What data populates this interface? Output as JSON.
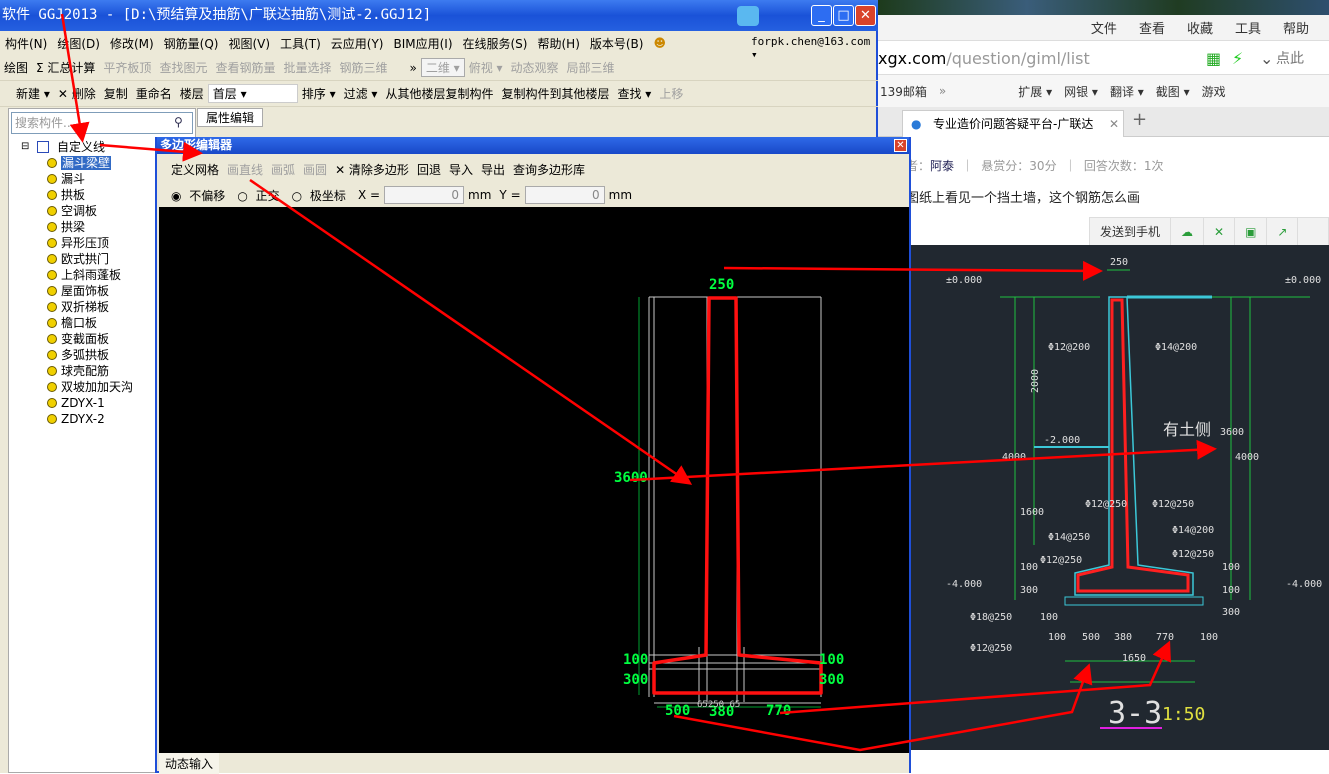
{
  "app": {
    "title": "软件 GGJ2013 - [D:\\预结算及抽筋\\广联达抽筋\\测试-2.GGJ12]",
    "menu": [
      "构件(N)",
      "绘图(D)",
      "修改(M)",
      "钢筋量(Q)",
      "视图(V)",
      "工具(T)",
      "云应用(Y)",
      "BIM应用(I)",
      "在线服务(S)",
      "帮助(H)",
      "版本号(B)"
    ],
    "account": "forpk.chen@163.com ▾",
    "toolbar1": [
      {
        "label": "绘图",
        "disabled": false
      },
      {
        "label": "Σ 汇总计算",
        "disabled": false
      },
      {
        "label": "平齐板顶",
        "disabled": true
      },
      {
        "label": "查找图元",
        "disabled": true
      },
      {
        "label": "查看钢筋量",
        "disabled": true
      },
      {
        "label": "批量选择",
        "disabled": true
      },
      {
        "label": "钢筋三维",
        "disabled": true
      },
      {
        "label": "二维 ▾",
        "disabled": true
      },
      {
        "label": "俯视 ▾",
        "disabled": true
      },
      {
        "label": "动态观察",
        "disabled": true
      },
      {
        "label": "局部三维",
        "disabled": true
      }
    ],
    "toolbar2": [
      {
        "label": "新建 ▾"
      },
      {
        "label": "✕ 删除"
      },
      {
        "label": "复制"
      },
      {
        "label": "重命名"
      },
      {
        "label": "楼层"
      },
      {
        "label": "首层 ▾"
      },
      {
        "label": "排序 ▾"
      },
      {
        "label": "过滤 ▾"
      },
      {
        "label": "从其他楼层复制构件"
      },
      {
        "label": "复制构件到其他楼层"
      },
      {
        "label": "查找 ▾"
      },
      {
        "label": "上移"
      }
    ],
    "search_placeholder": "搜索构件...",
    "property_tab": "属性编辑",
    "tree": {
      "root": "自定义线",
      "items": [
        "漏斗梁壁",
        "漏斗",
        "拱板",
        "空调板",
        "拱梁",
        "异形压顶",
        "欧式拱门",
        "上斜雨蓬板",
        "屋面饰板",
        "双折梯板",
        "檐口板",
        "变截面板",
        "多弧拱板",
        "球壳配筋",
        "双坡加加天沟",
        "ZDYX-1",
        "ZDYX-2"
      ],
      "selected": "漏斗梁壁"
    }
  },
  "dialog": {
    "title": "多边形编辑器",
    "toolbar": [
      {
        "label": "定义网格",
        "disabled": false
      },
      {
        "label": "画直线",
        "disabled": true
      },
      {
        "label": "画弧",
        "disabled": true
      },
      {
        "label": "画圆",
        "disabled": true
      },
      {
        "label": "✕ 清除多边形",
        "disabled": false
      },
      {
        "label": "回退",
        "disabled": false
      },
      {
        "label": "导入",
        "disabled": false
      },
      {
        "label": "导出",
        "disabled": false
      },
      {
        "label": "查询多边形库",
        "disabled": false
      }
    ],
    "modes": [
      {
        "label": "不偏移",
        "checked": true
      },
      {
        "label": "正交",
        "checked": false
      },
      {
        "label": "极坐标",
        "checked": false
      }
    ],
    "x_label": "X =",
    "x_value": "0",
    "y_label": "Y =",
    "y_value": "0",
    "unit": "mm",
    "dims": {
      "top": "250",
      "height": "3600",
      "left_upper": "100",
      "left_lower": "300",
      "right_upper": "100",
      "right_lower": "300",
      "bottom": [
        "500",
        "380",
        "770"
      ],
      "small": "65250 65"
    },
    "status": "动态输入"
  },
  "browser": {
    "menu": [
      "文件",
      "查看",
      "收藏",
      "工具",
      "帮助"
    ],
    "url_host": "xgx.com",
    "url_path": "/question/giml/list",
    "search_hint": "点此",
    "bookmarks": [
      "139邮箱",
      "扩展 ▾",
      "网银 ▾",
      "翻译 ▾",
      "截图 ▾",
      "游戏"
    ],
    "tab_title": "专业造价问题答疑平台-广联达",
    "meta": {
      "asker_label": "者：",
      "asker": "阿泰",
      "reward": "悬赏分：30分",
      "answers": "回答次数：1次"
    },
    "question": "图纸上看见一个挡土墙，这个钢筋怎么画",
    "tools": [
      "发送到手机",
      "☁",
      "✕",
      "▣",
      "↗"
    ]
  },
  "cad": {
    "labels": [
      "250",
      "±0.000",
      "±0.000",
      "Φ12@200",
      "Φ14@200",
      "2000",
      "有土侧",
      "3600",
      "4000",
      "4000",
      "-2.000",
      "1600",
      "Φ12@250",
      "Φ12@250",
      "Φ14@250",
      "Φ14@200",
      "Φ12@250",
      "Φ12@250",
      "100",
      "300",
      "100",
      "-4.000",
      "-4.000",
      "100",
      "300",
      "100",
      "Φ18@250",
      "Φ12@250",
      "100",
      "500",
      "380",
      "770",
      "100",
      "1650"
    ],
    "title": "3-3",
    "scale": "1:50"
  },
  "colors": {
    "accent": "#1f4fd8",
    "dim_green": "#00ff40",
    "polygon_red": "#ff1010",
    "cad_bg": "#212830"
  }
}
